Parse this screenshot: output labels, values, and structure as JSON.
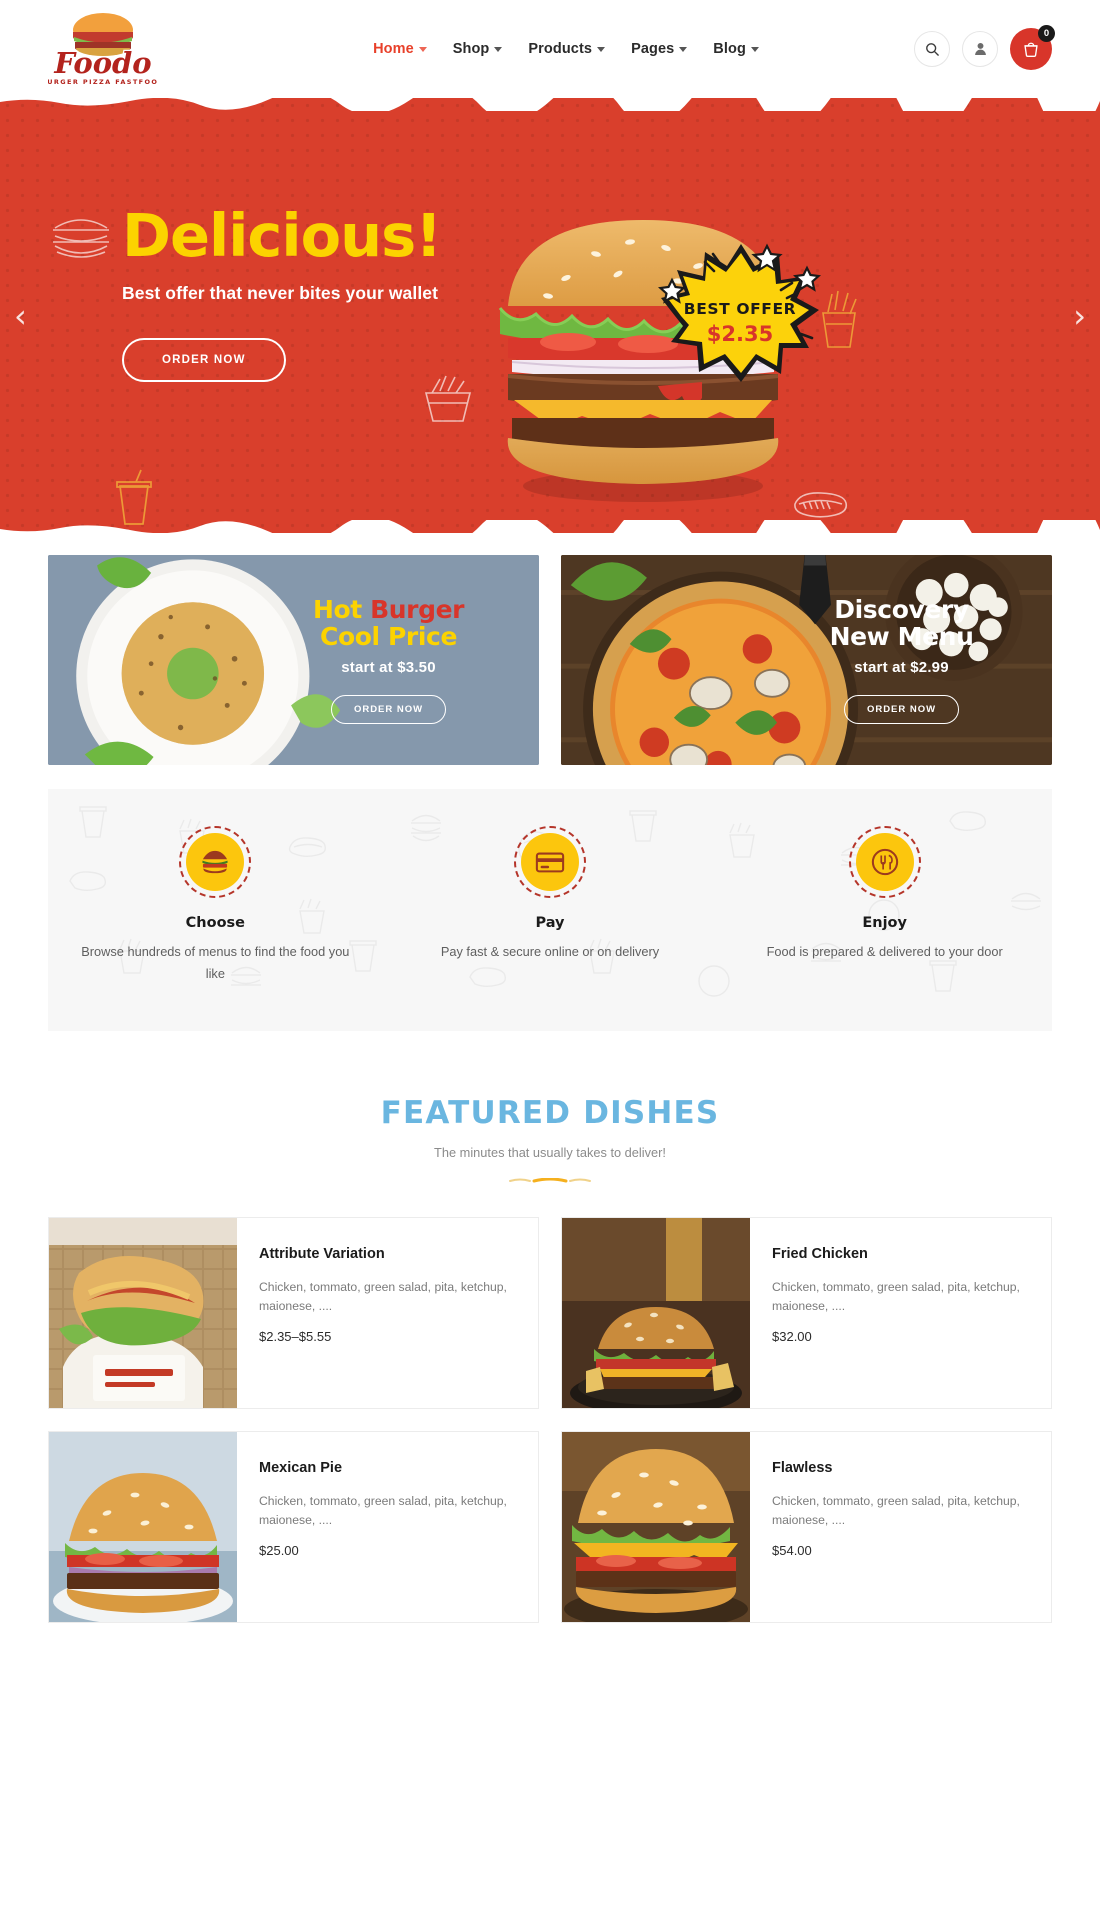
{
  "brand": {
    "name": "Foodo",
    "tagline": "BURGER PIZZA FASTFOOD"
  },
  "header": {
    "nav": [
      {
        "label": "Home",
        "active": true
      },
      {
        "label": "Shop",
        "active": false
      },
      {
        "label": "Products",
        "active": false
      },
      {
        "label": "Pages",
        "active": false
      },
      {
        "label": "Blog",
        "active": false
      }
    ],
    "search_icon": "search-icon",
    "account_icon": "user-icon",
    "cart_icon": "cart-icon",
    "cart_count": "0"
  },
  "hero": {
    "title": "Delicious!",
    "subtitle": "Best offer that never bites your wallet",
    "cta": "ORDER NOW",
    "badge_label": "BEST OFFER",
    "badge_price": "$2.35",
    "prev_arrow": "‹",
    "next_arrow": "›",
    "bg_color": "#d93f2c",
    "title_color": "#fcd300"
  },
  "promos": [
    {
      "title_line1_a": "Hot ",
      "title_line1_b": "Burger",
      "title_line2": "Cool Price",
      "price": "start at $3.50",
      "cta": "ORDER NOW",
      "style": "left"
    },
    {
      "title_line1_a": "Discovery",
      "title_line1_b": "",
      "title_line2": "New Menu",
      "price": "start at $2.99",
      "cta": "ORDER NOW",
      "style": "right"
    }
  ],
  "steps": [
    {
      "icon": "burger-icon",
      "title": "Choose",
      "desc": "Browse hundreds of menus to find the food you like"
    },
    {
      "icon": "credit-card-icon",
      "title": "Pay",
      "desc": "Pay fast & secure online or on delivery"
    },
    {
      "icon": "plate-cutlery-icon",
      "title": "Enjoy",
      "desc": "Food is prepared & delivered to your door"
    }
  ],
  "featured": {
    "title": "FEATURED DISHES",
    "subtitle": "The minutes that usually takes to deliver!",
    "title_color": "#6ab6e0"
  },
  "dishes": [
    {
      "name": "Attribute Variation",
      "desc": "Chicken, tommato, green salad, pita, ketchup, maionese, ....",
      "price": "$2.35–$5.55",
      "photo": "sandwich-basket"
    },
    {
      "name": "Fried Chicken",
      "desc": "Chicken, tommato, green salad, pita, ketchup, maionese, ....",
      "price": "$32.00",
      "photo": "burger-plate"
    },
    {
      "name": "Mexican Pie",
      "desc": "Chicken, tommato, green salad, pita, ketchup, maionese, ....",
      "price": "$25.00",
      "photo": "burger-blue"
    },
    {
      "name": "Flawless",
      "desc": "Chicken, tommato, green salad, pita, ketchup, maionese, ....",
      "price": "$54.00",
      "photo": "burger-cheese"
    }
  ]
}
